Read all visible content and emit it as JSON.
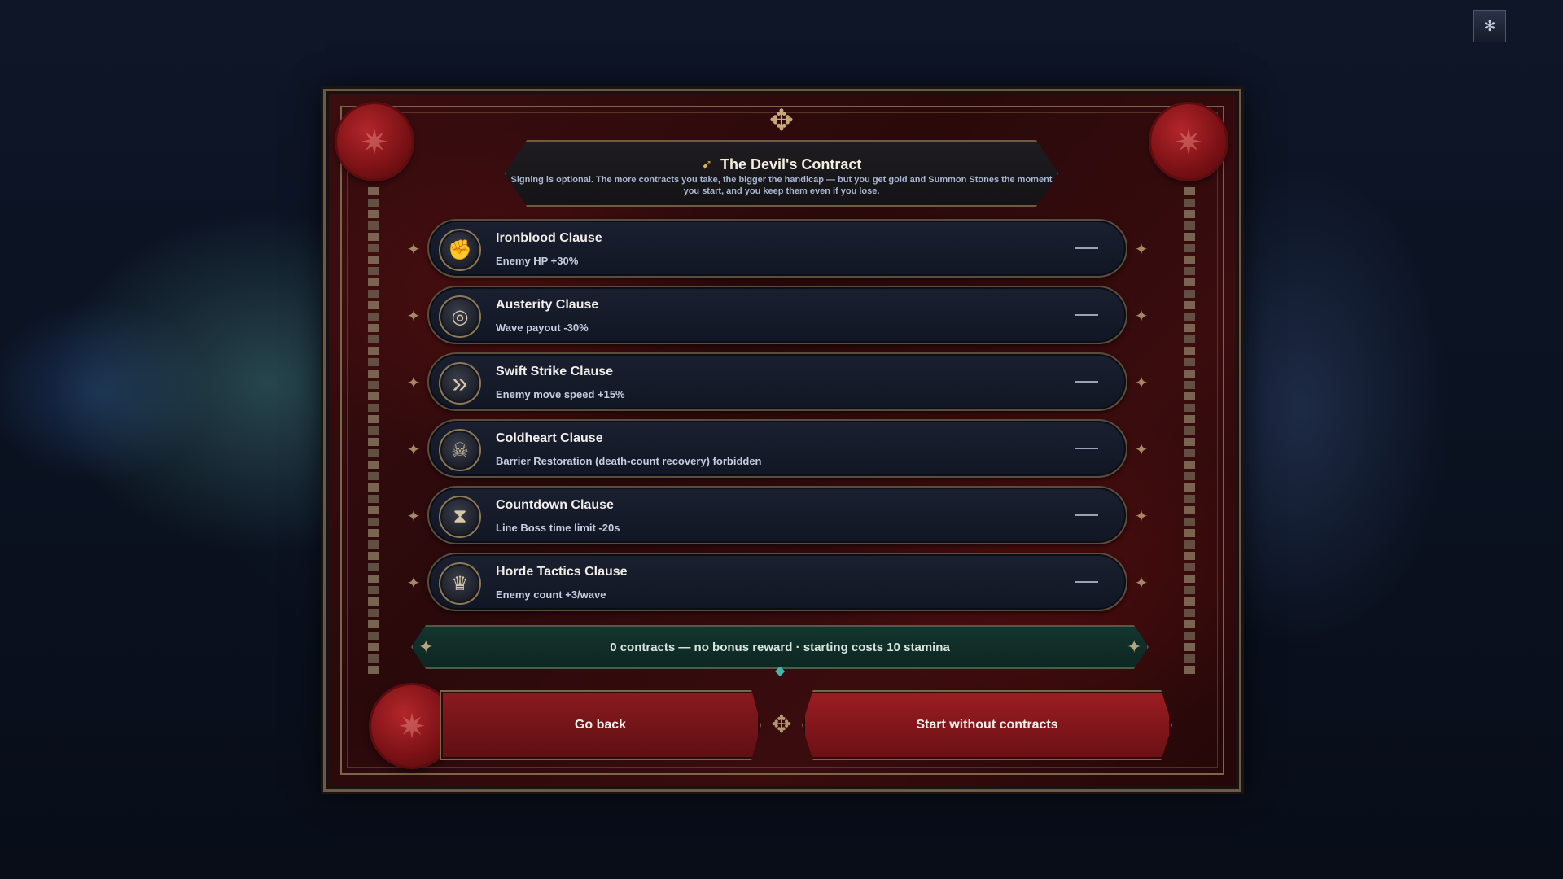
{
  "settings": {
    "icon": "gear-icon",
    "glyph": "✻"
  },
  "dialog": {
    "title": "The Devil's Contract",
    "title_icon": "scroll-icon",
    "title_glyph": "➹",
    "subtitle": "Signing is optional. The more contracts you take, the bigger the handicap — but you get gold and Summon Stones the moment you start, and you keep them even if you lose."
  },
  "clauses": [
    {
      "name": "Ironblood Clause",
      "desc": "Enemy HP +30%",
      "icon": "gauntlet-icon",
      "glyph": "✊",
      "toggle": "—"
    },
    {
      "name": "Austerity Clause",
      "desc": "Wave payout -30%",
      "icon": "coins-icon",
      "glyph": "◎",
      "toggle": "—"
    },
    {
      "name": "Swift Strike Clause",
      "desc": "Enemy move speed +15%",
      "icon": "double-chevron-icon",
      "glyph": "»",
      "toggle": "—"
    },
    {
      "name": "Coldheart Clause",
      "desc": "Barrier Restoration (death-count recovery) forbidden",
      "icon": "skull-icon",
      "glyph": "☠",
      "toggle": "—"
    },
    {
      "name": "Countdown Clause",
      "desc": "Line Boss time limit -20s",
      "icon": "hourglass-icon",
      "glyph": "⧗",
      "toggle": "—"
    },
    {
      "name": "Horde Tactics Clause",
      "desc": "Enemy count +3/wave",
      "icon": "crown-icon",
      "glyph": "♛",
      "toggle": "—"
    }
  ],
  "summary": {
    "text": "0 contracts — no bonus reward · starting costs 10 stamina"
  },
  "buttons": {
    "back": "Go back",
    "start": "Start without contracts"
  },
  "colors": {
    "frame_red": "#3b0d0f",
    "gold_trim": "#7a6648",
    "summary_teal": "#14352f",
    "button_red": "#8a1a1f"
  }
}
